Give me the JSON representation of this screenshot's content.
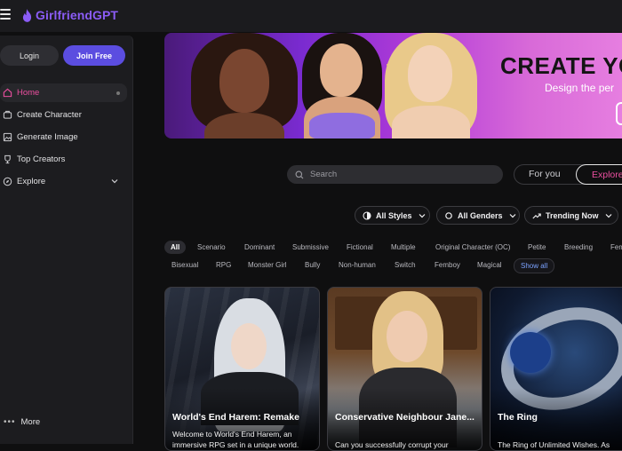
{
  "header": {
    "logo_text": "GirlfriendGPT",
    "menu_icon": "hamburger-icon",
    "brand_color": "#8b5cf6"
  },
  "sidebar": {
    "login_label": "Login",
    "join_label": "Join Free",
    "items": [
      {
        "label": "Home",
        "icon": "home-icon"
      },
      {
        "label": "Create Character",
        "icon": "create-icon"
      },
      {
        "label": "Generate Image",
        "icon": "image-icon"
      },
      {
        "label": "Top Creators",
        "icon": "trophy-icon"
      },
      {
        "label": "Explore",
        "icon": "compass-icon"
      }
    ],
    "more_label": "More",
    "active_color": "#ec4fa0"
  },
  "banner": {
    "title": "CREATE YOU",
    "subtitle": "Design the per"
  },
  "search": {
    "placeholder": "Search"
  },
  "view_toggle": {
    "for_you": "For you",
    "explore": "Explore"
  },
  "filters": {
    "styles": "All Styles",
    "genders": "All Genders",
    "sort": "Trending Now"
  },
  "tags": {
    "row1": [
      "All",
      "Scenario",
      "Dominant",
      "Submissive",
      "Fictional",
      "Multiple",
      "Original Character (OC)",
      "Petite",
      "Breeding",
      "Fem"
    ],
    "row2": [
      "Bisexual",
      "RPG",
      "Monster Girl",
      "Bully",
      "Non-human",
      "Switch",
      "Femboy",
      "Magical"
    ],
    "show_all": "Show all"
  },
  "cards": [
    {
      "title": "World's End Harem: Remake",
      "description": "Welcome to World's End Harem, an immersive RPG set in a unique world."
    },
    {
      "title": "Conservative Neighbour Jane...",
      "description": "Can you successfully corrupt your"
    },
    {
      "title": "The Ring",
      "description": "The Ring of Unlimited Wishes. As"
    }
  ]
}
